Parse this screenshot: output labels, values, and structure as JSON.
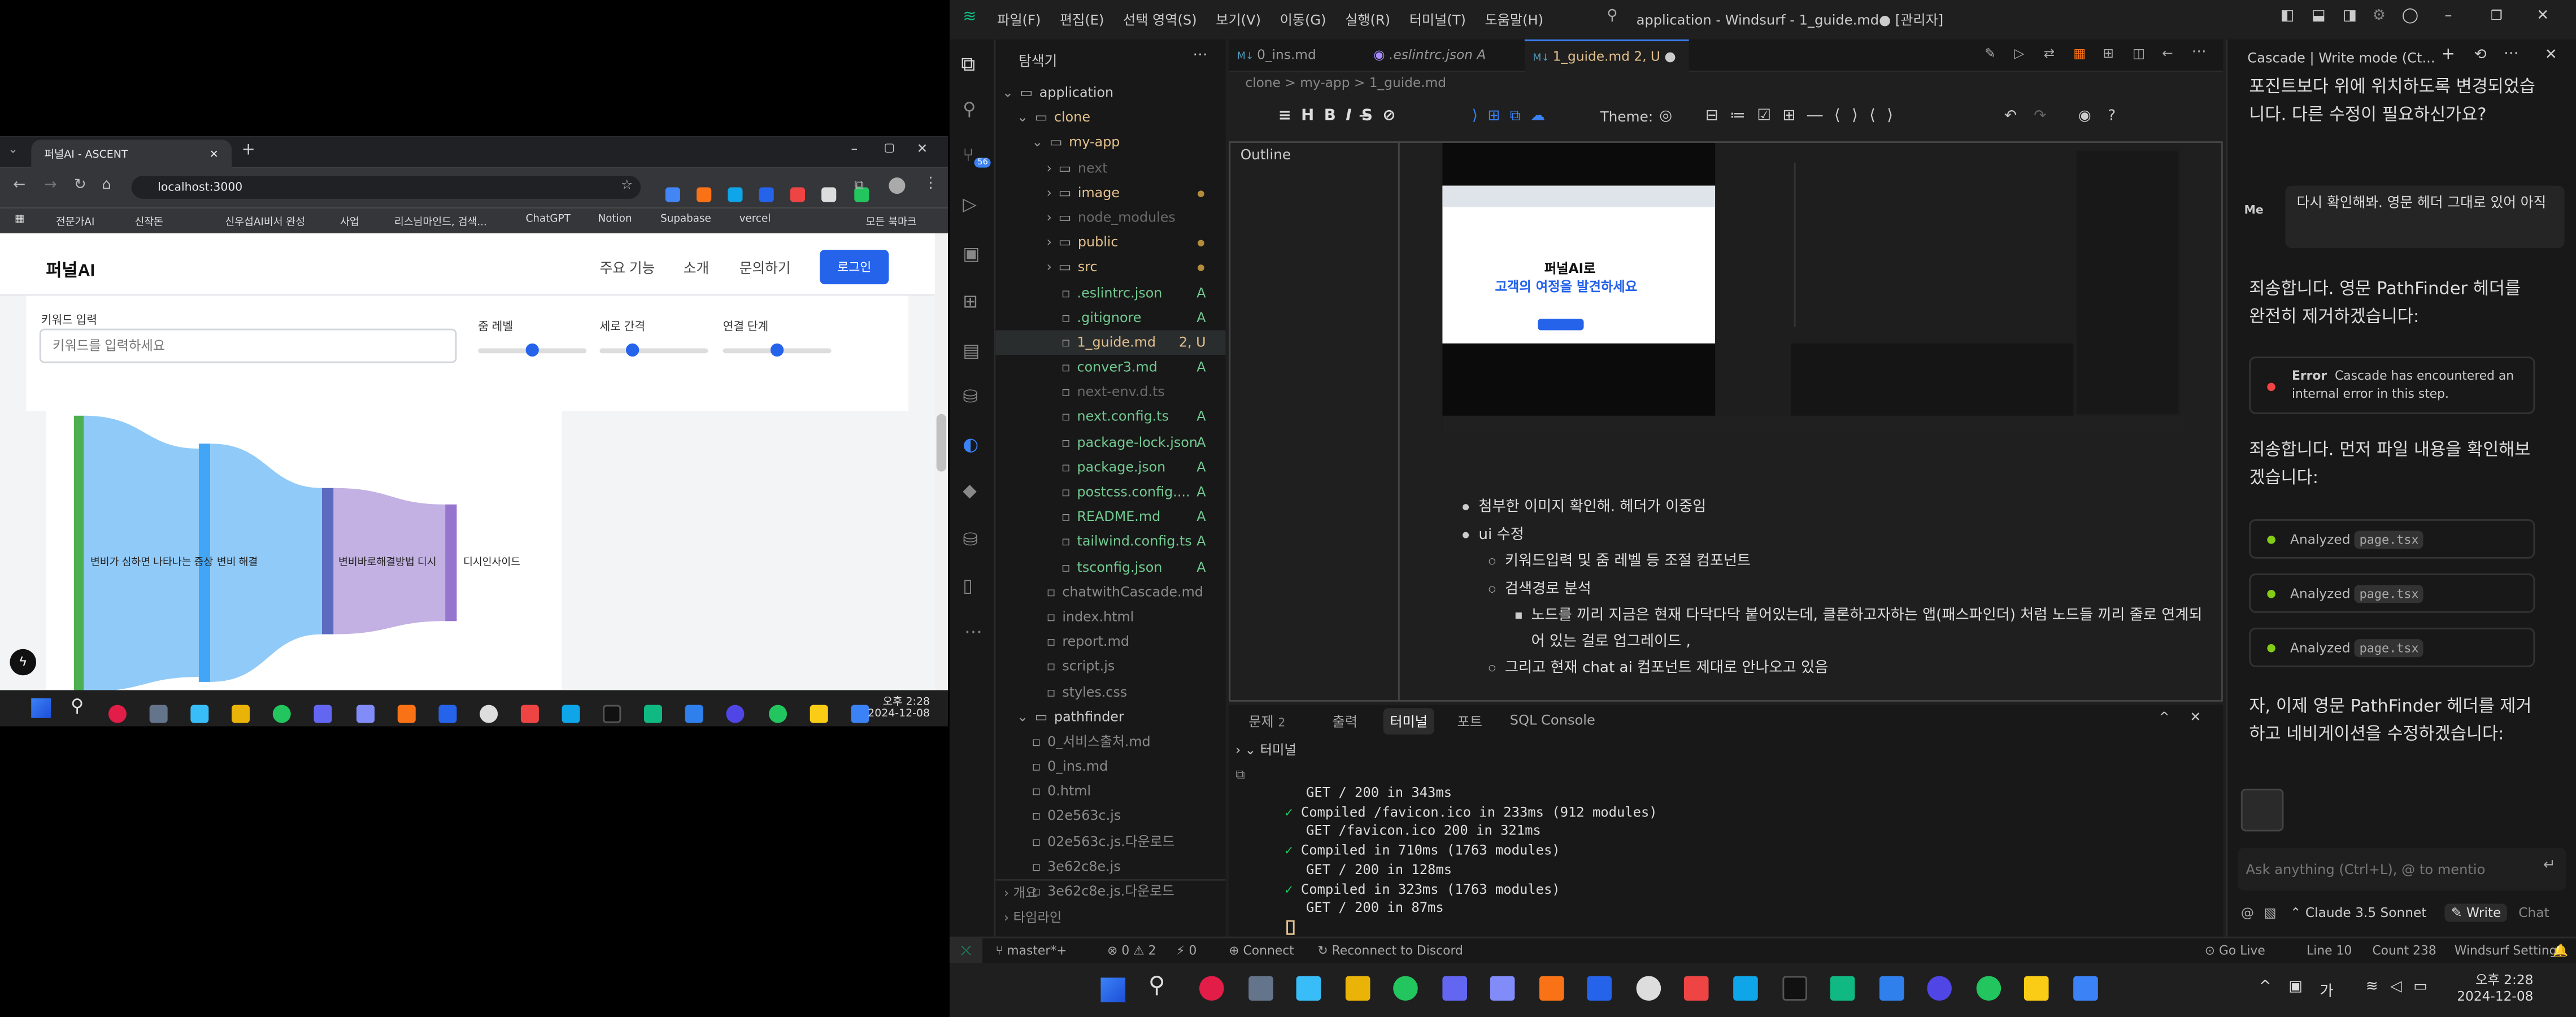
{
  "browser": {
    "tab_title": "퍼널AI - ASCENT",
    "url": "localhost:3000",
    "bookmarks": [
      "전문가AI",
      "신작돈",
      "신우섭AI비서 완성",
      "사업",
      "리스님마인드, 검색...",
      "ChatGPT",
      "Notion",
      "Supabase",
      "vercel",
      "모든 북마크"
    ],
    "site": {
      "logo": "퍼널AI",
      "nav": [
        "주요 기능",
        "소개",
        "문의하기"
      ],
      "login": "로그인",
      "keyword_label": "키워드 입력",
      "keyword_placeholder": "키워드를 입력하세요",
      "sliders": [
        {
          "label": "줌 레벨",
          "value": 0.5
        },
        {
          "label": "세로 간격",
          "value": 0.3
        },
        {
          "label": "연결 단계",
          "value": 0.5
        }
      ],
      "sankey_nodes": [
        "변비가 심하면 나타나는 증상",
        "변비 해결",
        "변비바로해결방법 디시",
        "디시인사이드"
      ]
    },
    "taskbar_time": "오후 2:28",
    "taskbar_date": "2024-12-08"
  },
  "vscode": {
    "menu": [
      "파일(F)",
      "편집(E)",
      "선택 영역(S)",
      "보기(V)",
      "이동(G)",
      "실행(R)",
      "터미널(T)",
      "도움말(H)"
    ],
    "title": "application - Windsurf - 1_guide.md● [관리자]",
    "explorer_title": "탐색기",
    "tree": [
      {
        "name": "application",
        "indent": 0,
        "status": "",
        "kind": "folder-open",
        "color": "#ccc"
      },
      {
        "name": "clone",
        "indent": 1,
        "status": "",
        "kind": "folder-open",
        "color": "#e2c08d"
      },
      {
        "name": "my-app",
        "indent": 2,
        "status": "",
        "kind": "folder-open",
        "color": "#e2c08d"
      },
      {
        "name": "next",
        "indent": 3,
        "status": "",
        "kind": "folder",
        "color": "#6b6b6b"
      },
      {
        "name": "image",
        "indent": 3,
        "status": "",
        "kind": "folder",
        "color": "#e2c08d"
      },
      {
        "name": "node_modules",
        "indent": 3,
        "status": "",
        "kind": "folder",
        "color": "#6b6b6b"
      },
      {
        "name": "public",
        "indent": 3,
        "status": "",
        "kind": "folder",
        "color": "#e2c08d"
      },
      {
        "name": "src",
        "indent": 3,
        "status": "",
        "kind": "folder",
        "color": "#e2c08d"
      },
      {
        "name": ".eslintrc.json",
        "indent": 4,
        "status": "A",
        "kind": "file",
        "color": "#73c991"
      },
      {
        "name": ".gitignore",
        "indent": 4,
        "status": "A",
        "kind": "file",
        "color": "#73c991"
      },
      {
        "name": "1_guide.md",
        "indent": 4,
        "status": "2, U",
        "kind": "file",
        "color": "#e2c08d"
      },
      {
        "name": "conver3.md",
        "indent": 4,
        "status": "A",
        "kind": "file",
        "color": "#73c991"
      },
      {
        "name": "next-env.d.ts",
        "indent": 4,
        "status": "",
        "kind": "file",
        "color": "#6b6b6b"
      },
      {
        "name": "next.config.ts",
        "indent": 4,
        "status": "A",
        "kind": "file",
        "color": "#73c991"
      },
      {
        "name": "package-lock.json",
        "indent": 4,
        "status": "A",
        "kind": "file",
        "color": "#73c991"
      },
      {
        "name": "package.json",
        "indent": 4,
        "status": "A",
        "kind": "file",
        "color": "#73c991"
      },
      {
        "name": "postcss.config....",
        "indent": 4,
        "status": "A",
        "kind": "file",
        "color": "#73c991"
      },
      {
        "name": "README.md",
        "indent": 4,
        "status": "A",
        "kind": "file",
        "color": "#73c991"
      },
      {
        "name": "tailwind.config.ts",
        "indent": 4,
        "status": "A",
        "kind": "file",
        "color": "#73c991"
      },
      {
        "name": "tsconfig.json",
        "indent": 4,
        "status": "A",
        "kind": "file",
        "color": "#73c991"
      },
      {
        "name": "chatwithCascade.md",
        "indent": 3,
        "status": "",
        "kind": "file",
        "color": "#8a8a8a"
      },
      {
        "name": "index.html",
        "indent": 3,
        "status": "",
        "kind": "file",
        "color": "#8a8a8a"
      },
      {
        "name": "report.md",
        "indent": 3,
        "status": "",
        "kind": "file",
        "color": "#8a8a8a"
      },
      {
        "name": "script.js",
        "indent": 3,
        "status": "",
        "kind": "file",
        "color": "#8a8a8a"
      },
      {
        "name": "styles.css",
        "indent": 3,
        "status": "",
        "kind": "file",
        "color": "#8a8a8a"
      },
      {
        "name": "pathfinder",
        "indent": 1,
        "status": "",
        "kind": "folder-open",
        "color": "#ccc"
      },
      {
        "name": "0_서비스출처.md",
        "indent": 2,
        "status": "",
        "kind": "file",
        "color": "#8a8a8a"
      },
      {
        "name": "0_ins.md",
        "indent": 2,
        "status": "",
        "kind": "file",
        "color": "#8a8a8a"
      },
      {
        "name": "0.html",
        "indent": 2,
        "status": "",
        "kind": "file",
        "color": "#8a8a8a"
      },
      {
        "name": "02e563c.js",
        "indent": 2,
        "status": "",
        "kind": "file",
        "color": "#8a8a8a"
      },
      {
        "name": "02e563c.js.다운로드",
        "indent": 2,
        "status": "",
        "kind": "file",
        "color": "#8a8a8a"
      },
      {
        "name": "3e62c8e.js",
        "indent": 2,
        "status": "",
        "kind": "file",
        "color": "#8a8a8a"
      },
      {
        "name": "3e62c8e.js.다운로드",
        "indent": 2,
        "status": "",
        "kind": "file",
        "color": "#8a8a8a"
      }
    ],
    "outline_sections": [
      "개요",
      "타임라인"
    ],
    "tabs": [
      {
        "label": "0_ins.md",
        "active": false
      },
      {
        "label": ".eslintrc.json A",
        "active": false
      },
      {
        "label": "1_guide.md 2, U",
        "active": true
      }
    ],
    "breadcrumb": "clone > my-app > 1_guide.md",
    "theme_label": "Theme:",
    "outline_label": "Outline",
    "editor_lines": [
      {
        "level": 1,
        "text": "첨부한 이미지 확인해. 헤더가 이중임"
      },
      {
        "level": 1,
        "text": "ui 수정"
      },
      {
        "level": 2,
        "text": "키워드입력 및 줌 레벨 등 조절 컴포넌트"
      },
      {
        "level": 2,
        "text": "검색경로 분석"
      },
      {
        "level": 3,
        "text": "노드를 끼리 지금은 현재 다닥다닥 붙어있는데, 클론하고자하는 앱(패스파인더) 처럼 노드들 끼리 줄로 연계되어 있는 걸로 업그레이드 ,"
      },
      {
        "level": 2,
        "text": "그리고 현재 chat ai 컴포넌트 제대로 안나오고 있음"
      }
    ],
    "preview_title_1": "퍼널AI로",
    "preview_title_2": "고객의 여정을 발견하세요",
    "panel_tabs": [
      "문제",
      "출력",
      "터미널",
      "포트",
      "SQL Console"
    ],
    "problems_count": "2",
    "terminal_title": "터미널",
    "terminal_lines": [
      {
        "check": false,
        "text": "GET / 200 in 343ms"
      },
      {
        "check": true,
        "text": "Compiled /favicon.ico in 233ms (912 modules)"
      },
      {
        "check": false,
        "text": "GET /favicon.ico 200 in 321ms"
      },
      {
        "check": true,
        "text": "Compiled in 710ms (1763 modules)"
      },
      {
        "check": false,
        "text": "GET / 200 in 128ms"
      },
      {
        "check": true,
        "text": "Compiled in 323ms (1763 modules)"
      },
      {
        "check": false,
        "text": "GET / 200 in 87ms"
      }
    ],
    "cascade_header": "Cascade | Write mode (Ct...",
    "chat_intro": "포진트보다 위에 위치하도록 변경되었습니다. 다른 수정이 필요하신가요?",
    "user_message": "다시 확인해봐. 영문 헤더 그대로 있어 아직",
    "user_avatar": "Me",
    "chat_reply_1": "죄송합니다. 영문 PathFinder 헤더를 완전히 제거하겠습니다:",
    "error_title": "Error",
    "error_text": "Cascade has encountered an internal error in this step.",
    "chat_reply_2": "죄송합니다. 먼저 파일 내용을 확인해보겠습니다:",
    "analyzed_label": "Analyzed",
    "analyzed_files": [
      "page.tsx",
      "page.tsx",
      "page.tsx"
    ],
    "chat_reply_3": "자, 이제 영문 PathFinder 헤더를 제거하고 네비게이션을 수정하겠습니다:",
    "chat_input_placeholder": "Ask anything (Ctrl+L), @ to mentio",
    "model": "Claude 3.5 Sonnet",
    "write_btn": "Write",
    "chat_btn": "Chat",
    "status_left": [
      "master*+",
      "⊗ 0 ⚠ 2",
      "⚡ 0",
      "Connect",
      "Reconnect to Discord"
    ],
    "status_right": [
      "Go Live",
      "Line 10",
      "Count 238",
      "Windsurf Settings"
    ],
    "taskbar_time": "오후 2:28",
    "taskbar_date": "2024-12-08"
  }
}
